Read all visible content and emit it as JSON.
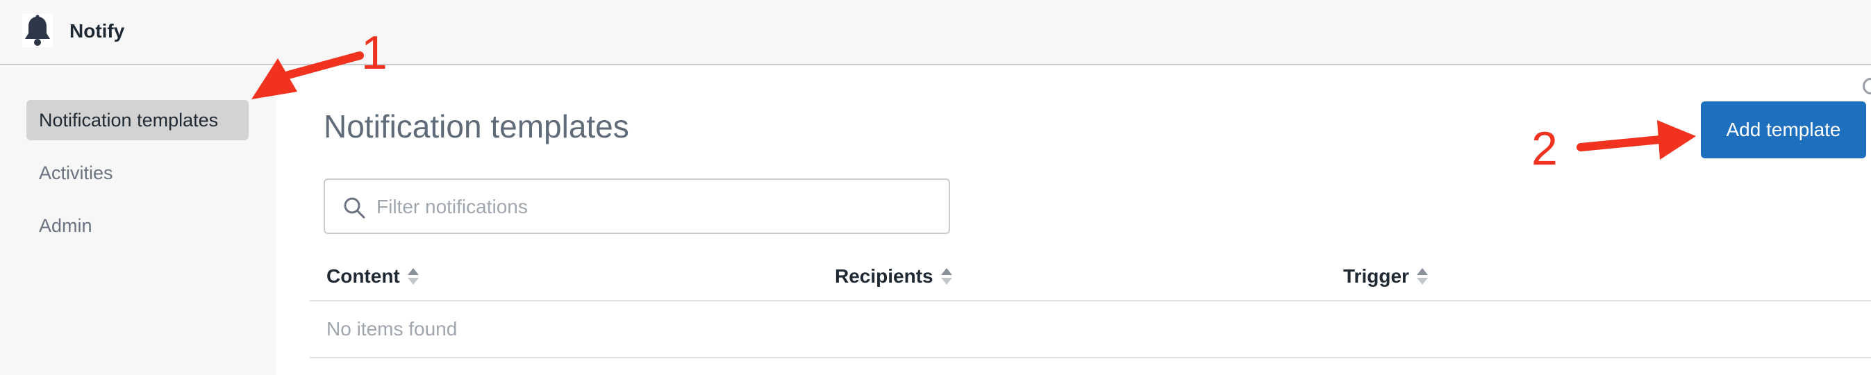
{
  "app": {
    "title": "Notify",
    "logo_icon": "bell-icon"
  },
  "sidebar": {
    "items": [
      {
        "label": "Notification templates",
        "active": true
      },
      {
        "label": "Activities",
        "active": false
      },
      {
        "label": "Admin",
        "active": false
      }
    ]
  },
  "main": {
    "title": "Notification templates",
    "add_button_label": "Add template",
    "search": {
      "placeholder": "Filter notifications",
      "value": "",
      "icon": "search-icon"
    },
    "table": {
      "columns": [
        "Content",
        "Recipients",
        "Trigger"
      ],
      "sort_icon": "sort-icon",
      "empty_text": "No items found"
    }
  },
  "annotations": {
    "labels": [
      "1",
      "2"
    ],
    "color": "#f0321e"
  },
  "colors": {
    "accent": "#1f6fbf",
    "active_nav_bg": "#d3d3d3"
  }
}
